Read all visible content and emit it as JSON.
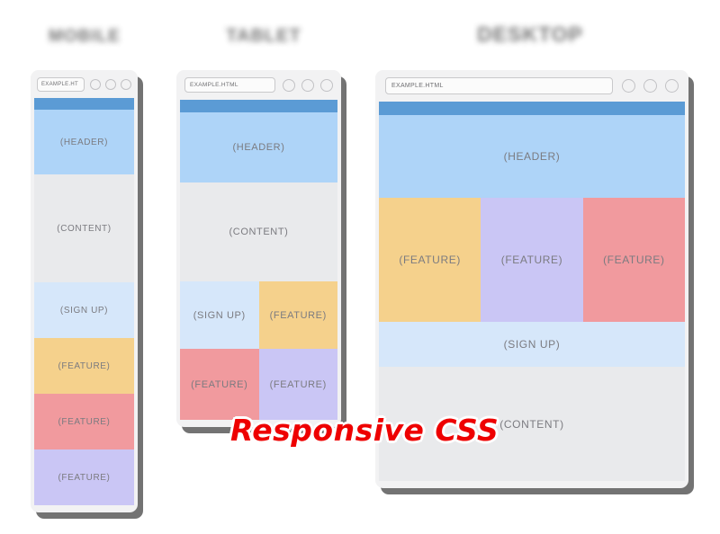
{
  "page": {
    "background": "#ffffff",
    "wordmark": "Responsive CSS",
    "wordmark_color": "#ee0000"
  },
  "titles": {
    "mobile": "MOBILE",
    "tablet": "TABLET",
    "desktop": "DESKTOP"
  },
  "palette": {
    "topbar": "#5b9bd5",
    "header": "#aed4f8",
    "content": "#e9eaec",
    "signup": "#d6e7fa",
    "feature_orange": "#f5d18c",
    "feature_red": "#f19a9e",
    "feature_purple": "#cac6f5",
    "device_shell": "#f2f2f3",
    "block_text": "#7b7b80"
  },
  "devices": [
    {
      "id": "mobile",
      "url": "EXAMPLE.HT",
      "url_placeholder": "EXAMPLE.HTML",
      "dots": [
        "window-dot-1",
        "window-dot-2",
        "window-dot-3"
      ],
      "blocks": [
        {
          "label": "(HEADER)",
          "color": "header"
        },
        {
          "label": "(CONTENT)",
          "color": "content"
        },
        {
          "label": "(SIGN UP)",
          "color": "signup"
        },
        {
          "label": "(FEATURE)",
          "color": "feature_orange"
        },
        {
          "label": "(FEATURE)",
          "color": "feature_red"
        },
        {
          "label": "(FEATURE)",
          "color": "feature_purple"
        }
      ]
    },
    {
      "id": "tablet",
      "url": "EXAMPLE.HTML",
      "url_placeholder": "EXAMPLE.HTML",
      "dots": [
        "window-dot-1",
        "window-dot-2",
        "window-dot-3"
      ],
      "blocks": [
        {
          "label": "(HEADER)",
          "color": "header"
        },
        {
          "label": "(CONTENT)",
          "color": "content"
        },
        {
          "label": "(SIGN UP)",
          "color": "signup"
        },
        {
          "label": "(FEATURE)",
          "color": "feature_orange"
        },
        {
          "label": "(FEATURE)",
          "color": "feature_red"
        },
        {
          "label": "(FEATURE)",
          "color": "feature_purple"
        }
      ]
    },
    {
      "id": "desktop",
      "url": "EXAMPLE.HTML",
      "url_placeholder": "EXAMPLE.HTML",
      "dots": [
        "window-dot-1",
        "window-dot-2",
        "window-dot-3"
      ],
      "blocks": [
        {
          "label": "(HEADER)",
          "color": "header"
        },
        {
          "label": "(FEATURE)",
          "color": "feature_orange"
        },
        {
          "label": "(FEATURE)",
          "color": "feature_purple"
        },
        {
          "label": "(FEATURE)",
          "color": "feature_red"
        },
        {
          "label": "(SIGN UP)",
          "color": "signup"
        },
        {
          "label": "(CONTENT)",
          "color": "content"
        }
      ]
    }
  ]
}
